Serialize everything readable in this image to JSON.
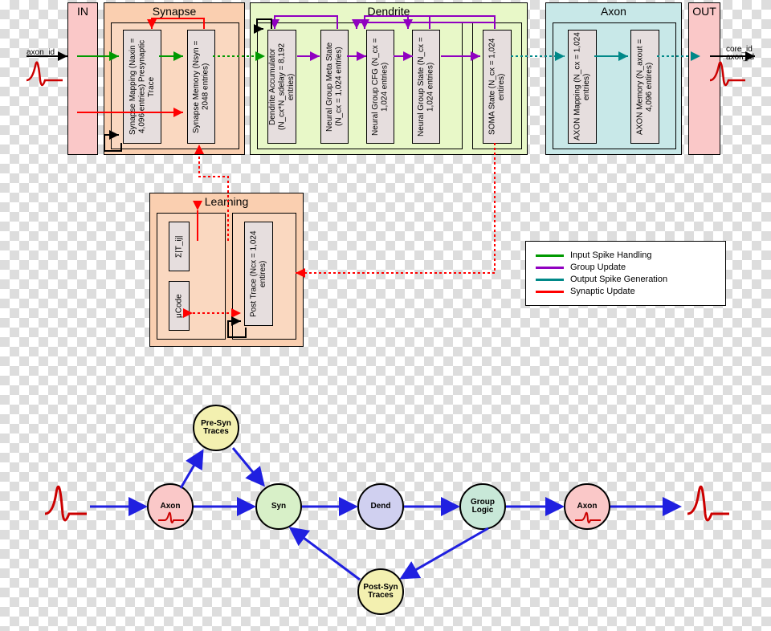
{
  "stages": {
    "in": {
      "label": "IN"
    },
    "synapse": {
      "label": "Synapse"
    },
    "dendrite": {
      "label": "Dendrite"
    },
    "axon": {
      "label": "Axon"
    },
    "out": {
      "label": "OUT"
    },
    "learning": {
      "label": "Learning"
    }
  },
  "mem": {
    "syn_mapping": "Synapse Mapping\n(Naxin = 4,096 entries)\nPresynaptic Trace",
    "syn_memory": "Synapse Memory\n(Nsyn = 2048 entries)",
    "dend_acc": "Dendrite Accumulator\n(N_cx*N_sdelay = 8,192 entries)",
    "ng_meta": "Neural Group Meta State\n(N_cx = 1,024 entries)",
    "ng_cfg": "Neural Group CFG\n(N_cx = 1,024 entries)",
    "ng_state": "Neural Group State\n(N_cx = 1,024 entries)",
    "soma": "SOMA State\n(N_cx = 1,024 entires)",
    "axon_map": "AXON Mapping\n(N_cx = 1,024 entries)",
    "axon_mem": "AXON Memory\n(N_axout = 4,096 entires)",
    "sigma": "Σ|T_ij|",
    "ucode": "μCode",
    "post_trace": "Post Trace\n(Ncx = 1,024 entires)"
  },
  "legend": {
    "items": [
      {
        "color": "#009900",
        "label": "Input Spike Handling"
      },
      {
        "color": "#9000c0",
        "label": "Group Update"
      },
      {
        "color": "#008888",
        "label": "Output Spike Generation"
      },
      {
        "color": "#ff0000",
        "label": "Synaptic Update"
      }
    ]
  },
  "signals": {
    "in": "axon_id",
    "out_top": "core_id",
    "out_bot": "axon_id"
  },
  "flow": {
    "nodes": {
      "axon_in": "Axon",
      "presyn": "Pre-Syn\nTraces",
      "syn": "Syn",
      "dend": "Dend",
      "group": "Group\nLogic",
      "axon_out": "Axon",
      "postsyn": "Post-Syn\nTraces"
    }
  },
  "colors": {
    "pink": "#fac8c8",
    "orange": "#facfb0",
    "green": "#e8f8c8",
    "blue": "#c8e8e8",
    "peach": "#fad8c0",
    "node_pink": "#fac8c8",
    "node_yellow": "#f3f0b0",
    "node_green": "#d8f0c8",
    "node_purple": "#d0d0f0",
    "node_teal": "#c8e8d8"
  }
}
